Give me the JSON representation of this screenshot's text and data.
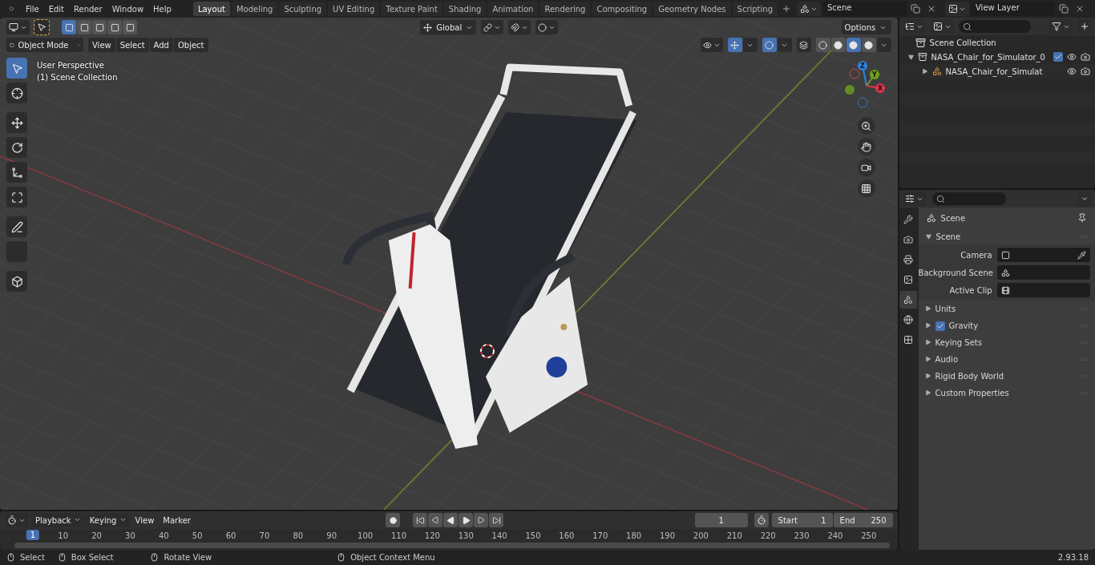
{
  "menu": [
    "File",
    "Edit",
    "Render",
    "Window",
    "Help"
  ],
  "workspaces": [
    {
      "label": "Layout",
      "selected": true
    },
    {
      "label": "Modeling",
      "selected": false
    },
    {
      "label": "Sculpting",
      "selected": false
    },
    {
      "label": "UV Editing",
      "selected": false
    },
    {
      "label": "Texture Paint",
      "selected": false
    },
    {
      "label": "Shading",
      "selected": false
    },
    {
      "label": "Animation",
      "selected": false
    },
    {
      "label": "Rendering",
      "selected": false
    },
    {
      "label": "Compositing",
      "selected": false
    },
    {
      "label": "Geometry Nodes",
      "selected": false
    },
    {
      "label": "Scripting",
      "selected": false
    }
  ],
  "scene_field": {
    "value": "Scene"
  },
  "view_layer_field": {
    "value": "View Layer"
  },
  "viewport": {
    "select_modes": [
      {
        "selected": true
      },
      {
        "selected": false
      },
      {
        "selected": false
      },
      {
        "selected": false
      },
      {
        "selected": false
      }
    ],
    "orientation": "Global",
    "options": "Options",
    "mode": "Object Mode",
    "menus": [
      "View",
      "Select",
      "Add",
      "Object"
    ],
    "overlay_text": [
      "User Perspective",
      "(1) Scene Collection"
    ],
    "tools": [
      {
        "kind": "select",
        "selected": true
      },
      {
        "kind": "cursor",
        "selected": false
      },
      {
        "kind": "move",
        "selected": false
      },
      {
        "kind": "rotate",
        "selected": false
      },
      {
        "kind": "scale",
        "selected": false
      },
      {
        "kind": "transform",
        "selected": false
      },
      {
        "kind": "annotate",
        "selected": false
      },
      {
        "kind": "measure",
        "selected": false
      },
      {
        "kind": "add-cube",
        "selected": false
      }
    ],
    "gizmo_axes": [
      {
        "label": "Z",
        "color": "#2f83e0"
      },
      {
        "label": "Y",
        "color": "#6ea01e"
      },
      {
        "label": "X",
        "color": "#e0354b"
      }
    ],
    "shading": [
      {
        "selected": false
      },
      {
        "selected": false
      },
      {
        "selected": true
      },
      {
        "selected": false
      }
    ]
  },
  "outliner": {
    "root": "Scene Collection",
    "items": [
      {
        "label": "NASA_Chair_for_Simulator_0",
        "expanded": true,
        "checked": true,
        "children": [
          {
            "label": "NASA_Chair_for_Simulat",
            "expanded": false
          }
        ]
      }
    ]
  },
  "properties": {
    "tabs": [
      {
        "kind": "tool",
        "selected": false
      },
      {
        "kind": "render",
        "selected": false
      },
      {
        "kind": "output",
        "selected": false
      },
      {
        "kind": "view-layer",
        "selected": false
      },
      {
        "kind": "scene",
        "selected": true
      },
      {
        "kind": "world",
        "selected": false
      },
      {
        "kind": "texture",
        "selected": false
      }
    ],
    "context": "Scene",
    "panel_title": "Scene",
    "panel_expanded": true,
    "fields": [
      {
        "label": "Camera",
        "kind": "camera"
      },
      {
        "label": "Background Scene",
        "kind": "scene"
      },
      {
        "label": "Active Clip",
        "kind": "clip"
      }
    ],
    "sections": [
      {
        "title": "Units",
        "expanded": false
      },
      {
        "title": "Gravity",
        "expanded": false,
        "checked": true
      },
      {
        "title": "Keying Sets",
        "expanded": false
      },
      {
        "title": "Audio",
        "expanded": false
      },
      {
        "title": "Rigid Body World",
        "expanded": false
      },
      {
        "title": "Custom Properties",
        "expanded": false
      }
    ]
  },
  "timeline": {
    "menus": [
      "Playback",
      "Keying",
      "View",
      "Marker"
    ],
    "current_frame": "1",
    "start_label": "Start",
    "start": "1",
    "end_label": "End",
    "end": "250",
    "ticks": [
      "1",
      "10",
      "20",
      "30",
      "40",
      "50",
      "60",
      "70",
      "80",
      "90",
      "100",
      "110",
      "120",
      "130",
      "140",
      "150",
      "160",
      "170",
      "180",
      "190",
      "200",
      "210",
      "220",
      "230",
      "240",
      "250"
    ]
  },
  "status_bar": {
    "hints": [
      "Select",
      "Box Select",
      "Rotate View",
      "Object Context Menu"
    ],
    "version": "2.93.18"
  }
}
